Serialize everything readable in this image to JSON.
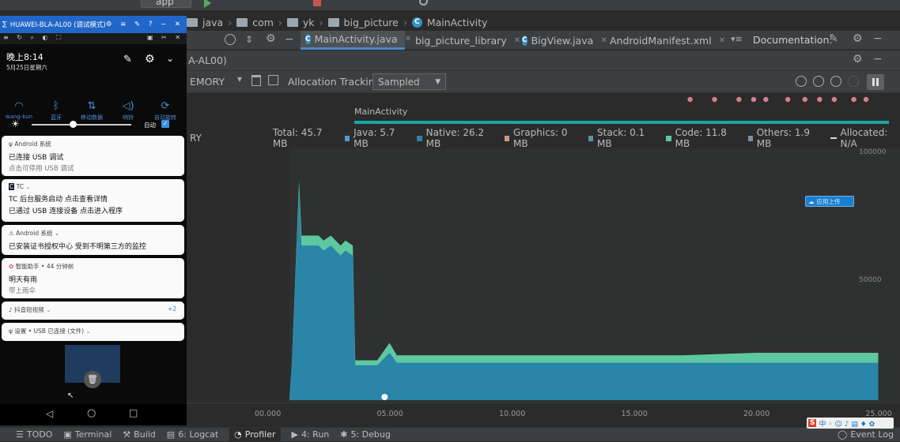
{
  "ide": {
    "breadcrumb": [
      "java",
      "com",
      "yk",
      "big_picture",
      "MainActivity"
    ],
    "toolbar": {
      "run_config": "app"
    },
    "tabs": [
      {
        "label": "MainActivity.java",
        "active": true
      },
      {
        "label": "big_picture_library",
        "active": false
      },
      {
        "label": "BigView.java",
        "active": false
      },
      {
        "label": "AndroidManifest.xml",
        "active": false
      }
    ],
    "documentation_label": "Documentation:",
    "device_label": "A-AL00)",
    "profiler": {
      "memory_label": "EMORY",
      "allocation_tracking_label": "Allocation Tracking",
      "allocation_tracking_value": "Sampled",
      "activity_label": "MainActivity"
    }
  },
  "legend": {
    "partial_label": "RY",
    "total": "Total: 45.7 MB",
    "items": [
      {
        "label": "Java: 5.7 MB",
        "color": "#4a9ad4"
      },
      {
        "label": "Native: 26.2 MB",
        "color": "#2f7fa8"
      },
      {
        "label": "Graphics: 0 MB",
        "color": "#c99a80"
      },
      {
        "label": "Stack: 0.1 MB",
        "color": "#5a8fa3"
      },
      {
        "label": "Code: 11.8 MB",
        "color": "#5ec8a0"
      },
      {
        "label": "Others: 1.9 MB",
        "color": "#7d8f9a"
      },
      {
        "label": "Allocated: N/A",
        "color": "#dddddd"
      }
    ]
  },
  "chart_data": {
    "type": "area",
    "x": [
      0.9,
      1.0,
      1.3,
      1.4,
      2.1,
      2.3,
      2.6,
      3.0,
      3.2,
      3.5,
      3.6,
      4.5,
      5.0,
      5.3,
      5.6,
      16.0,
      17.0,
      20.0,
      25.0
    ],
    "series": [
      {
        "name": "Native",
        "values": [
          0,
          14,
          84,
          62,
          62,
          60,
          62,
          58,
          60,
          58,
          14,
          14,
          19,
          15,
          15,
          15,
          15,
          15,
          15
        ]
      },
      {
        "name": "Code",
        "values": [
          0,
          0,
          4,
          4,
          4,
          4,
          4,
          4,
          4,
          4,
          2,
          2,
          4,
          3,
          3,
          3,
          3,
          4,
          4
        ]
      }
    ],
    "x_ticks": [
      "00.000",
      "05.000",
      "10.000",
      "15.000",
      "20.000",
      "25.000"
    ],
    "y_ticks": [
      "100000",
      "50000"
    ],
    "event_dots_x": [
      17.3,
      18.3,
      19.3,
      19.9,
      20.4,
      21.3,
      22.0,
      22.6,
      23.2,
      24.0,
      24.5
    ]
  },
  "tooltip_badge": "应用上传",
  "phone": {
    "window_title": "HUAWEI-BLA-AL00 (调试模式)",
    "time": "晚上8:14",
    "date": "5月25日星期六",
    "quick_settings": [
      {
        "label": "wang-kun",
        "icon": "wifi-icon"
      },
      {
        "label": "蓝牙",
        "icon": "bluetooth-icon"
      },
      {
        "label": "移动数据",
        "icon": "data-icon"
      },
      {
        "label": "响铃",
        "icon": "ring-icon"
      },
      {
        "label": "自动旋转",
        "icon": "rotate-icon"
      }
    ],
    "auto_brightness": "自动",
    "notifications": [
      {
        "app": "Android 系统",
        "title": "已连接 USB 调试",
        "text": "点击可停用 USB 调试"
      },
      {
        "app": "TC",
        "title": "TC 后台服务启动 点击查看详情",
        "text": "已通过 USB 连接设备 点击进入程序"
      },
      {
        "app": "Android 系统",
        "title": "已安装证书授权中心 受到不明第三方的监控",
        "text": ""
      },
      {
        "app": "智能助手 • 44 分钟前",
        "title": "明天有雨",
        "text": "带上雨伞"
      },
      {
        "app": "抖音短视频",
        "title": "",
        "text": "",
        "badge": "+2"
      },
      {
        "app": "设置 • USB 已连接 (文件)",
        "title": "",
        "text": ""
      }
    ]
  },
  "bottom_tabs": [
    "TODO",
    "Terminal",
    "Build",
    "6: Logcat",
    "Profiler",
    "4: Run",
    "5: Debug"
  ],
  "event_log": "Event Log"
}
